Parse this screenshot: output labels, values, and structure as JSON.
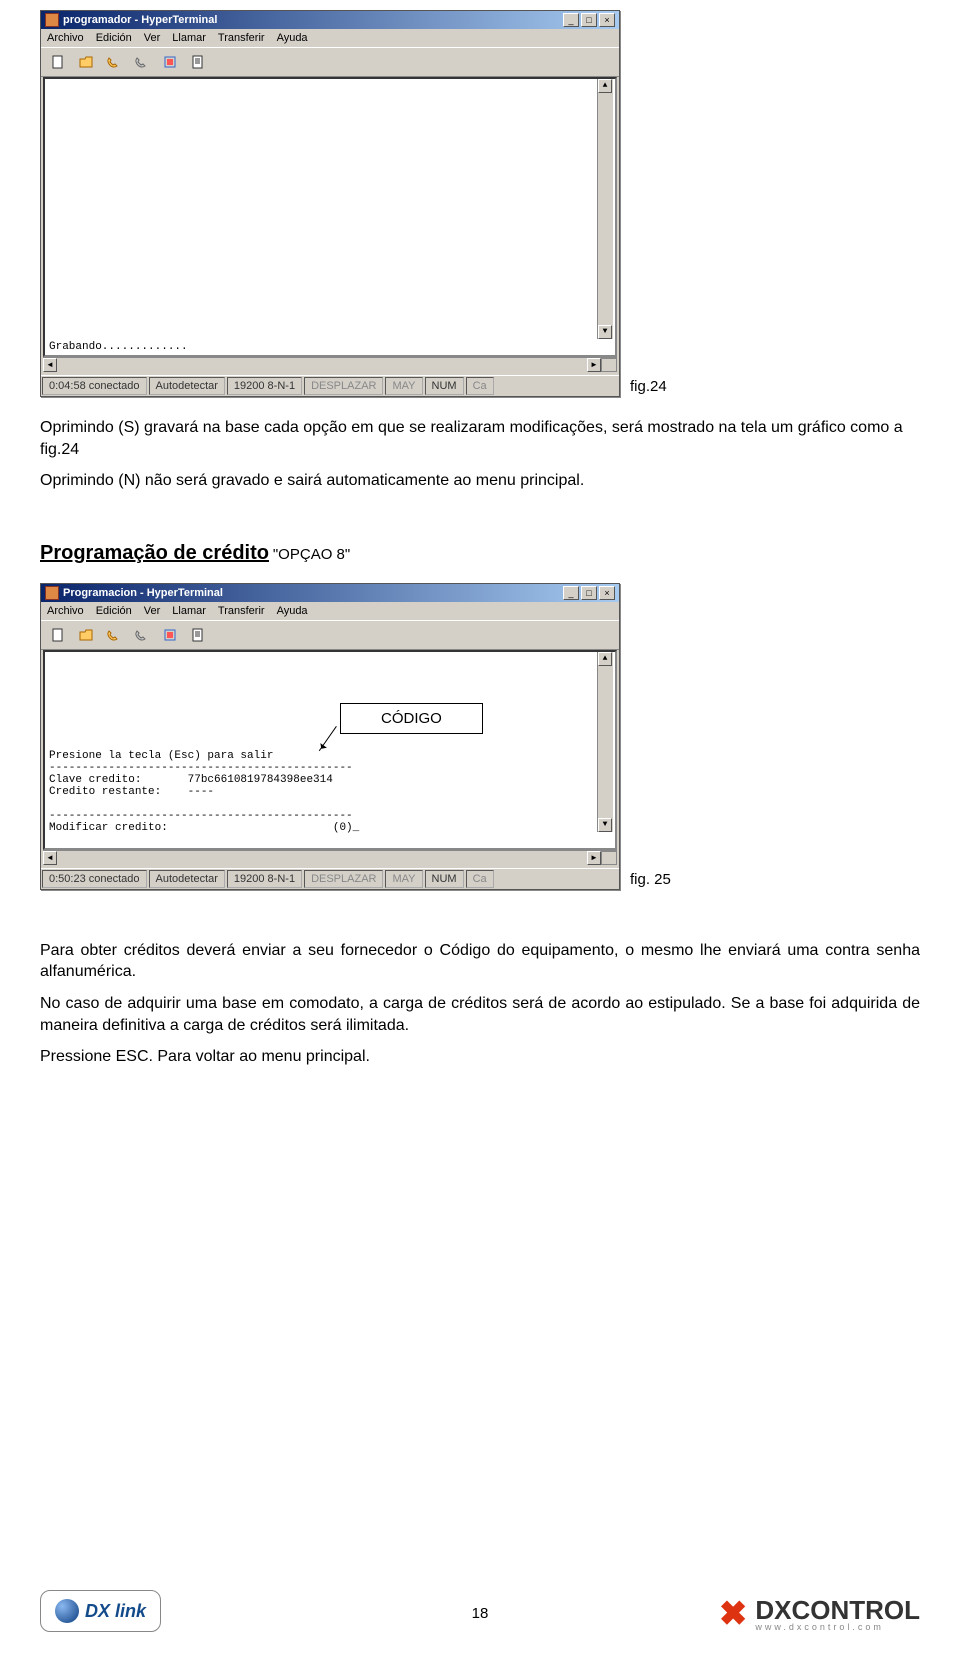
{
  "ht1": {
    "title": "programador - HyperTerminal",
    "menu": [
      "Archivo",
      "Edición",
      "Ver",
      "Llamar",
      "Transferir",
      "Ayuda"
    ],
    "term_bottom": "Grabando.............",
    "status": {
      "time": "0:04:58 conectado",
      "detect": "Autodetectar",
      "conn": "19200 8-N-1",
      "desp": "DESPLAZAR",
      "may": "MAY",
      "num": "NUM",
      "ca": "Ca"
    }
  },
  "fig24_label": "fig.24",
  "para1": "Oprimindo (S) gravará na base cada opção em que se realizaram modificações, será mostrado na tela um gráfico como a fig.24",
  "para2": "Oprimindo (N) não será gravado e sairá automaticamente ao menu principal.",
  "section_title": "Programação de crédito",
  "section_suffix": " \"OPÇAO  8\"",
  "codigo_label": "CÓDIGO",
  "ht2": {
    "title": "Programacion - HyperTerminal",
    "menu": [
      "Archivo",
      "Edición",
      "Ver",
      "Llamar",
      "Transferir",
      "Ayuda"
    ],
    "term_lines": [
      "Presione la tecla (Esc) para salir",
      "----------------------------------------------",
      "Clave credito:       77bc6610819784398ee314",
      "Credito restante:    ----",
      "",
      "----------------------------------------------",
      "Modificar credito:                         (0)_"
    ],
    "status": {
      "time": "0:50:23 conectado",
      "detect": "Autodetectar",
      "conn": "19200 8-N-1",
      "desp": "DESPLAZAR",
      "may": "MAY",
      "num": "NUM",
      "ca": "Ca"
    }
  },
  "fig25_label": "fig. 25",
  "para3": "Para obter créditos deverá enviar a seu fornecedor o Código do equipamento, o mesmo lhe enviará uma contra senha alfanumérica.",
  "para4": "No caso de adquirir uma base em comodato, a carga de créditos será de acordo ao estipulado. Se a base foi adquirida de maneira definitiva a carga de créditos será ilimitada.",
  "para5": "Pressione ESC. Para voltar ao menu principal.",
  "page_number": "18",
  "logo_dxlink": "DX link",
  "logo_dxcontrol": "DXCONTROL",
  "logo_dxcontrol_sub": "www.dxcontrol.com"
}
